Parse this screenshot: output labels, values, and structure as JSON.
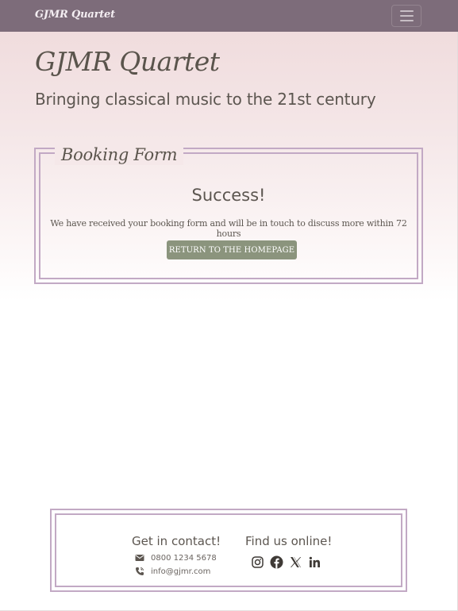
{
  "navbar": {
    "brand": "GJMR Quartet"
  },
  "hero": {
    "title": "GJMR Quartet",
    "subtitle": "Bringing classical music to the 21st century"
  },
  "booking": {
    "legend": "Booking Form",
    "success_title": "Success!",
    "message": "We have received your booking form and will be in touch to discuss more within 72 hours",
    "button_label": "RETURN TO THE HOMEPAGE"
  },
  "footer": {
    "contact_title": "Get in contact!",
    "phone": "0800 1234 5678",
    "email": "info@gjmr.com",
    "online_title": "Find us online!",
    "social_icons": [
      "instagram-icon",
      "facebook-icon",
      "x-twitter-icon",
      "linkedin-icon"
    ]
  },
  "colors": {
    "navbar_bg": "#7d6c7a",
    "frame_border": "#c2a9c4",
    "button_bg": "#8b947d",
    "text": "#5c5650"
  }
}
